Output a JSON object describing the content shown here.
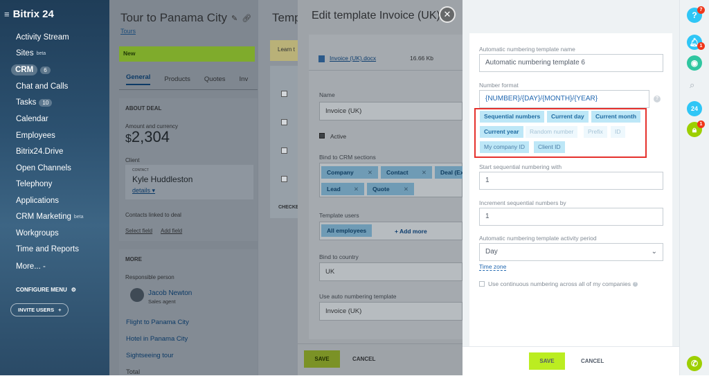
{
  "leftnav": {
    "logo": "Bitrix 24",
    "items": [
      {
        "label": "Activity Stream"
      },
      {
        "label": "Sites",
        "sup": "beta"
      },
      {
        "label": "CRM",
        "count": "6"
      },
      {
        "label": "Chat and Calls"
      },
      {
        "label": "Tasks",
        "count": "10"
      },
      {
        "label": "Calendar"
      },
      {
        "label": "Employees"
      },
      {
        "label": "Bitrix24.Drive"
      },
      {
        "label": "Open Channels"
      },
      {
        "label": "Telephony"
      },
      {
        "label": "Applications"
      },
      {
        "label": "CRM Marketing",
        "sup": "beta"
      },
      {
        "label": "Workgroups"
      },
      {
        "label": "Time and Reports"
      },
      {
        "label": "More... -"
      }
    ],
    "configure_menu": "CONFIGURE MENU",
    "invite_users": "INVITE USERS"
  },
  "deal": {
    "title": "Tour to Panama City",
    "category": "Tours",
    "stage": "New",
    "tabs": [
      "General",
      "Products",
      "Quotes",
      "Inv"
    ],
    "about_deal": "ABOUT DEAL",
    "amount_label": "Amount and currency",
    "currency_symbol": "$",
    "amount": "2,304",
    "client_label": "Client",
    "contact_tag": "CONTACT",
    "client_name": "Kyle Huddleston",
    "details": "details",
    "contacts_linked": "Contacts linked to deal",
    "select_field": "Select field",
    "add_field": "Add field",
    "more": "MORE",
    "responsible_label": "Responsible person",
    "responsible_name": "Jacob Newton",
    "responsible_role": "Sales agent",
    "links": [
      "Flight to Panama City",
      "Hotel in Panama City",
      "Sightseeing tour",
      "Total"
    ]
  },
  "templates": {
    "title": "Temp",
    "learn": "Learn t",
    "checked": "CHECKE"
  },
  "edit_template": {
    "title": "Edit template Invoice (UK)",
    "file_name": "Invoice (UK).docx",
    "file_size": "16.66 Kb",
    "name_label": "Name",
    "name_value": "Invoice (UK)",
    "active_label": "Active",
    "bind_sections_label": "Bind to CRM sections",
    "sections": [
      "Company",
      "Contact",
      "Deal (Ex",
      "Lead",
      "Quote"
    ],
    "users_label": "Template users",
    "users_tag": "All employees",
    "add_more": "+ Add more",
    "country_label": "Bind to country",
    "country_value": "UK",
    "auto_label": "Use auto numbering template",
    "auto_value": "Invoice (UK)",
    "save": "SAVE",
    "cancel": "CANCEL"
  },
  "numbering": {
    "name_label": "Automatic numbering template name",
    "name_value": "Automatic numbering template  6",
    "format_label": "Number format",
    "format_value": "{NUMBER}/{DAY}/{MONTH}/{YEAR}",
    "tags": [
      {
        "label": "Sequential numbers",
        "state": "on"
      },
      {
        "label": "Current day",
        "state": "on"
      },
      {
        "label": "Current month",
        "state": "on"
      },
      {
        "label": "Current year",
        "state": "on"
      },
      {
        "label": "Random number",
        "state": "off"
      },
      {
        "label": "Prefix",
        "state": "off"
      },
      {
        "label": "ID",
        "state": "off"
      },
      {
        "label": "My company ID",
        "state": "on2"
      },
      {
        "label": "Client ID",
        "state": "on2"
      }
    ],
    "start_label": "Start sequential numbering with",
    "start_value": "1",
    "increment_label": "Increment sequential numbers by",
    "increment_value": "1",
    "period_label": "Automatic numbering template activity period",
    "period_value": "Day",
    "time_zone": "Time zone",
    "continuous_label": "Use continuous numbering across all of my companies",
    "save": "SAVE",
    "cancel": "CANCEL"
  },
  "rightbar": {
    "help_badge": "7",
    "notif_badge": "1",
    "lock_badge": "1",
    "b24_label": "24"
  }
}
